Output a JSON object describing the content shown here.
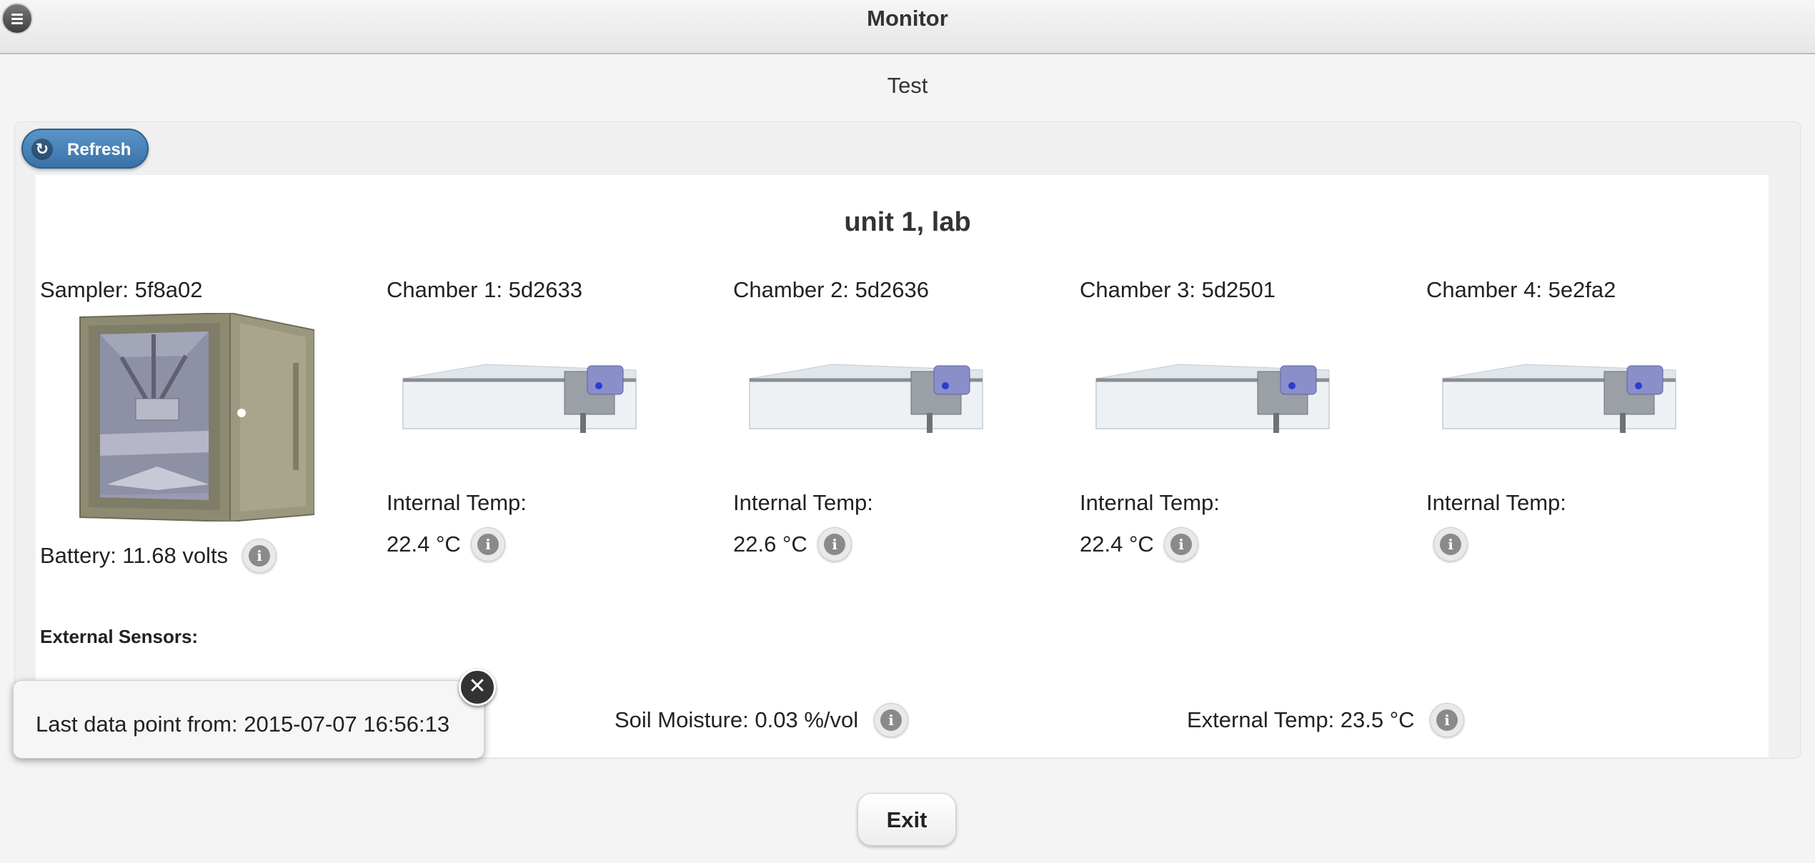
{
  "header": {
    "title": "Monitor",
    "menu_icon": "menu-icon"
  },
  "page": {
    "subtitle": "Test"
  },
  "toolbar": {
    "refresh_label": "Refresh",
    "refresh_icon": "refresh-icon"
  },
  "unit": {
    "title": "unit 1, lab"
  },
  "sampler": {
    "label": "Sampler: 5f8a02",
    "battery": "Battery: 11.68 volts"
  },
  "chambers": [
    {
      "label": "Chamber 1: 5d2633",
      "temp_label": "Internal Temp:",
      "temp_value": "22.4 °C"
    },
    {
      "label": "Chamber 2: 5d2636",
      "temp_label": "Internal Temp:",
      "temp_value": "22.6 °C"
    },
    {
      "label": "Chamber 3: 5d2501",
      "temp_label": "Internal Temp:",
      "temp_value": "22.4 °C"
    },
    {
      "label": "Chamber 4: 5e2fa2",
      "temp_label": "Internal Temp:",
      "temp_value": ""
    }
  ],
  "external": {
    "heading": "External Sensors:",
    "soil_moisture": "Soil Moisture: 0.03 %/vol",
    "external_temp": "External Temp: 23.5 °C"
  },
  "popup": {
    "text": "Last data point from: 2015-07-07 16:56:13",
    "close_glyph": "✕"
  },
  "footer": {
    "exit_label": "Exit"
  },
  "info_glyph": "i",
  "colors": {
    "refresh_button": "#3a72a8",
    "background": "#f4f4f4",
    "card": "#ffffff"
  }
}
